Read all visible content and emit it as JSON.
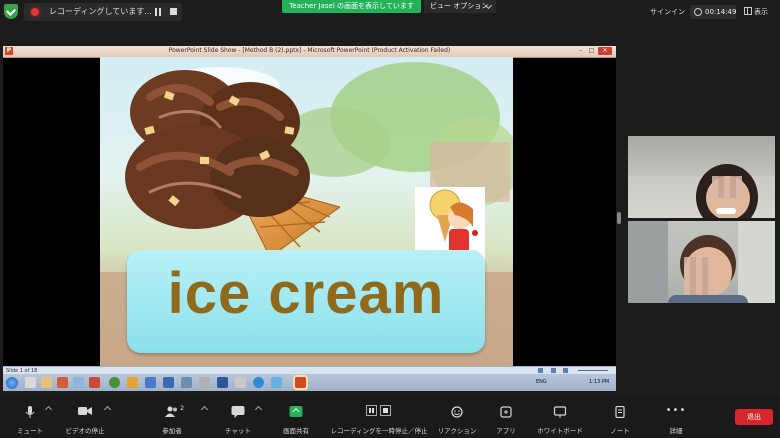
{
  "topbar": {
    "recording_label": "レコーディングしています...",
    "share_banner": "Teacher Jasel の画面を表示しています",
    "view_options": "ビュー オプション",
    "sign_in": "サインイン",
    "timer": "00:14:49",
    "view": "表示"
  },
  "shared_screen": {
    "window_title": "PowerPoint Slide Show - [Method B (2).pptx] - Microsoft PowerPoint (Product Activation Failed)",
    "app_logo": "P",
    "slide_word": "ice cream",
    "slide_counter": "Slide 1 of 18",
    "tray_lang": "ENG",
    "clock": "1:13 PM"
  },
  "toolbar": {
    "mute": "ミュート",
    "stop_video": "ビデオの停止",
    "participants": "参加者",
    "participants_count": "2",
    "chat": "チャット",
    "share_screen": "画面共有",
    "pause_recording": "レコーディングを一時停止／停止",
    "reactions": "リアクション",
    "apps": "アプリ",
    "whiteboard": "ホワイトボード",
    "notes": "ノート",
    "more": "詳細",
    "leave": "退出"
  },
  "colors": {
    "share_green": "#23b15a",
    "leave_red": "#d6252c",
    "slide_word": "#8f6a1d"
  }
}
